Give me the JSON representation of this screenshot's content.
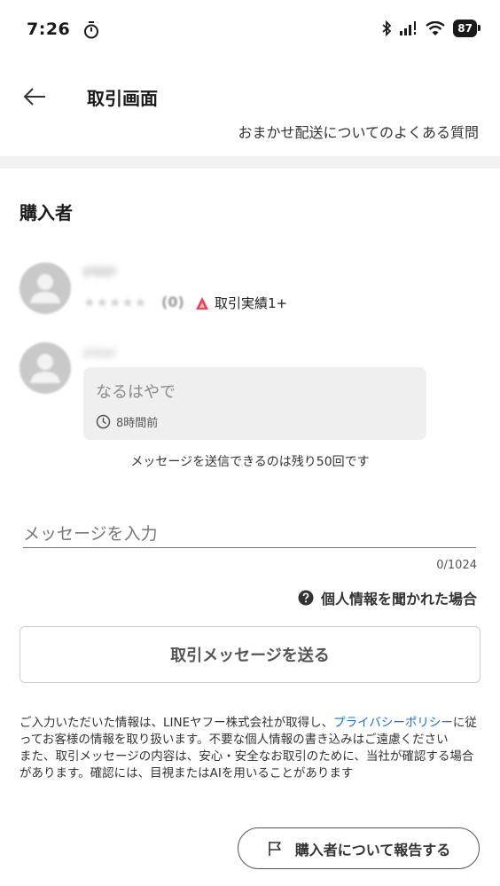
{
  "status_bar": {
    "time": "7:26",
    "battery": "87",
    "icons": [
      "timer-icon",
      "bluetooth-icon",
      "signal-icon",
      "wifi-icon",
      "battery-icon"
    ]
  },
  "header": {
    "title": "取引画面",
    "back_icon": "back-arrow-icon"
  },
  "cut_row": {
    "text": "おまかせ配送についてのよくある質問"
  },
  "buyer_section": {
    "title": "購入者",
    "buyer": {
      "name": "pippi",
      "stars": "★★★★★",
      "rating_count": "(0)",
      "record_label": "取引実績1+"
    }
  },
  "message": {
    "sender": "pippi",
    "text": "なるはやで",
    "time": "8時間前"
  },
  "remaining_text": "メッセージを送信できるのは残り50回です",
  "composer": {
    "placeholder": "メッセージを入力",
    "counter": "0/1024"
  },
  "help_link": {
    "label": "個人情報を聞かれた場合"
  },
  "send_button": {
    "label": "取引メッセージを送る"
  },
  "notice": {
    "part1": "ご入力いただいた情報は、LINEヤフー株式会社が取得し、",
    "privacy_link": "プライバシーポリシー",
    "part2": "に従ってお客様の情報を取り扱います。不要な個人情報の書き込みはご遠慮ください",
    "part3": "また、取引メッセージの内容は、安心・安全なお取引のために、当社が確認する場合があります。確認には、目視またはAIを用いることがあります"
  },
  "report_button": {
    "label": "購入者について報告する"
  },
  "colors": {
    "link": "#1a6fd4",
    "record_icon": "#e8455b",
    "bubble": "#efefef"
  }
}
